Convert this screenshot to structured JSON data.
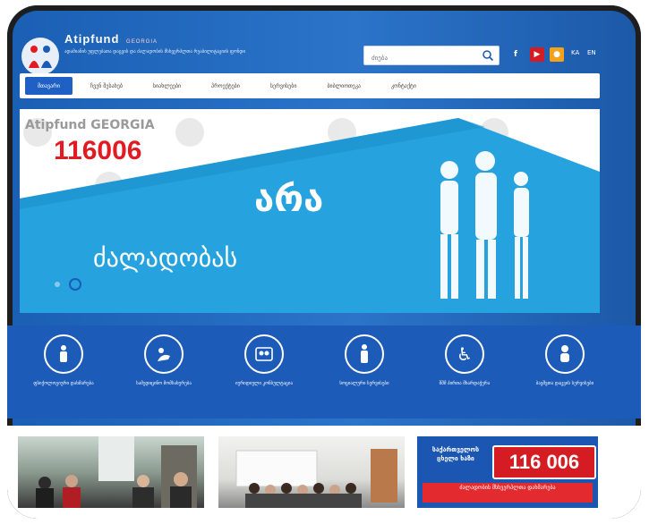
{
  "brand": {
    "name": "Atipfund",
    "sub": "GEORGIA",
    "tagline": "ადამიანის უფლებათა დაცვის და ძალადობის მსხვერპლთა რეაბილიტაციის ფონდი"
  },
  "search": {
    "placeholder": "ძიება"
  },
  "languages": {
    "ka": "KA",
    "en": "EN"
  },
  "nav": {
    "items": [
      {
        "label": "მთავარი"
      },
      {
        "label": "ჩვენ შესახებ"
      },
      {
        "label": "სიახლეები"
      },
      {
        "label": "პროექტები"
      },
      {
        "label": "სერვისები"
      },
      {
        "label": "ბიბლიოთეკა"
      },
      {
        "label": "კონტაქტი"
      }
    ]
  },
  "banner": {
    "hotline": "116006",
    "line1": "არა",
    "line2": "ძალადობას",
    "watermark": "Atipfund GEORGIA"
  },
  "services": [
    {
      "label": "ფსიქოლოგიური დახმარება"
    },
    {
      "label": "სამედიცინო მომსახურება"
    },
    {
      "label": "იურიდიული კონსულტაცია"
    },
    {
      "label": "სოციალური სერვისები"
    },
    {
      "label": "შშმ პირთა მხარდაჭერა"
    },
    {
      "label": "ბავშვთა დაცვის სერვისები"
    }
  ],
  "promo": {
    "text": "საქართველოს ცხელი ხაზი",
    "number": "116 006",
    "strip": "ძალადობის მსხვერპლთა დახმარება"
  },
  "colors": {
    "primary": "#1c5bb8",
    "accent": "#e21b23",
    "header": "#2b74c9"
  }
}
